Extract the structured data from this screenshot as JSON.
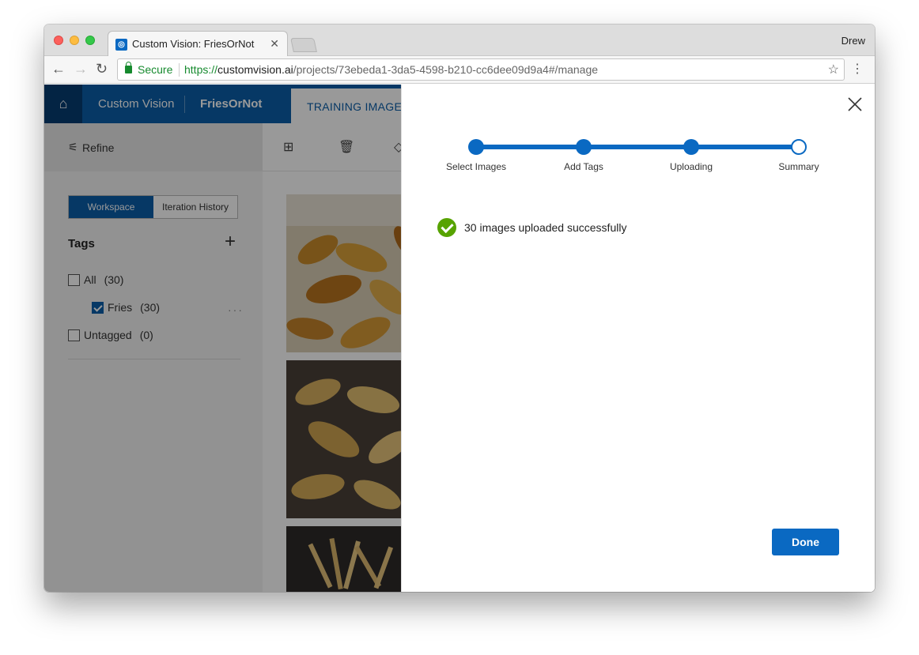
{
  "browser": {
    "tab_title": "Custom Vision: FriesOrNot",
    "tab_favicon_glyph": "◎",
    "profile_name": "Drew",
    "secure_label": "Secure",
    "url_scheme": "https://",
    "url_host": "customvision.ai",
    "url_path": "/projects/73ebeda1-3da5-4598-b210-cc6dee09d9a4#/manage"
  },
  "app": {
    "brand": "Custom Vision",
    "project": "FriesOrNot",
    "active_tab": "TRAINING IMAGES",
    "accent": "#0a5ea9"
  },
  "sidebar": {
    "refine_label": "Refine",
    "toggle": {
      "active": "Workspace",
      "inactive": "Iteration History"
    },
    "tags_title": "Tags",
    "tags": [
      {
        "label": "All",
        "count": "(30)",
        "checked": false
      },
      {
        "label": "Fries",
        "count": "(30)",
        "checked": true
      },
      {
        "label": "Untagged",
        "count": "(0)",
        "checked": false
      }
    ]
  },
  "upload_panel": {
    "steps": [
      {
        "label": "Select Images",
        "complete": true
      },
      {
        "label": "Add Tags",
        "complete": true
      },
      {
        "label": "Uploading",
        "complete": true
      },
      {
        "label": "Summary",
        "complete": false
      }
    ],
    "success_message": "30 images uploaded successfully",
    "done_label": "Done",
    "success_color": "#57a300"
  }
}
